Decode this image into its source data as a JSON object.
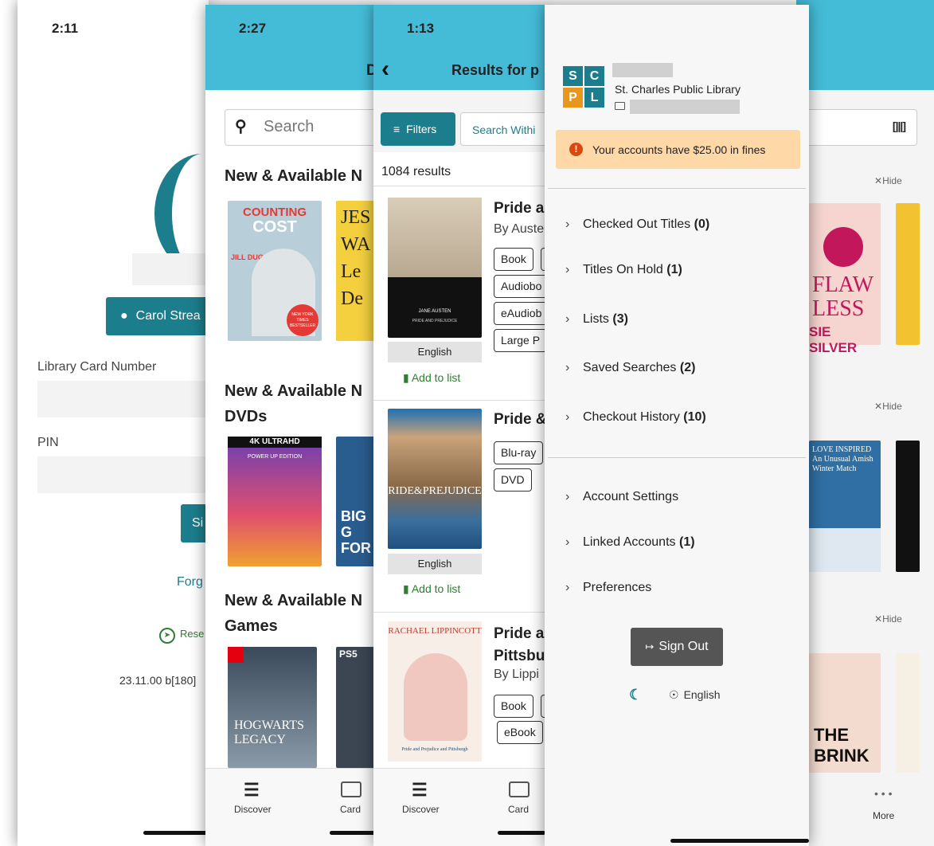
{
  "login": {
    "time": "2:11",
    "location_button": "Carol Strea",
    "card_label": "Library Card Number",
    "pin_label": "PIN",
    "sign_in_partial": "Si",
    "forgot_partial": "Forg",
    "reset_partial": "Rese",
    "version": "23.11.00 b[180]"
  },
  "discover": {
    "time": "2:27",
    "header_partial": "D",
    "search_placeholder": "Search",
    "section1": "New & Available N",
    "section2_line1": "New & Available N",
    "section2_line2": "DVDs",
    "section3_line1": "New & Available N",
    "section3_line2": "Games",
    "covers": [
      {
        "title": "COUNTING THE COST",
        "author": "JILL DUGGAR",
        "badge": "NEW YORK TIMES BESTSELLER"
      },
      {
        "title": "JES WA Le De",
        "author": ""
      },
      {
        "title": "4K ULTRAHD",
        "subtitle": "POWER UP EDITION"
      },
      {
        "title": "BIG G FOR",
        "author": ""
      },
      {
        "title": "HOGWARTS LEGACY",
        "author": ""
      },
      {
        "title": "PS5",
        "author": ""
      }
    ],
    "nav": {
      "discover": "Discover",
      "card": "Card"
    }
  },
  "results": {
    "time": "1:13",
    "title": "Results for p",
    "filters": "Filters",
    "search_within": "Search Withi",
    "count": "1084 results",
    "items": [
      {
        "title": "Pride a",
        "author": "By Auste",
        "formats": [
          "Book",
          "Audiobo",
          "eAudiob",
          "Large P"
        ],
        "language": "English",
        "add": "Add to list",
        "cover_lines": [
          "JANE AUSTEN",
          "PRIDE AND PREJUDICE"
        ]
      },
      {
        "title": "Pride &",
        "author": "",
        "formats": [
          "Blu-ray",
          "DVD"
        ],
        "language": "English",
        "add": "Add to list",
        "cover_lines": [
          "RIDE&PREJUDICE"
        ]
      },
      {
        "title": "Pride a",
        "title2": "Pittsbu",
        "author": "By Lippi",
        "formats": [
          "Book",
          "eBook"
        ],
        "cover_lines": [
          "RACHAEL LIPPINCOTT",
          "Pride and Prejudice and Pittsburgh"
        ]
      }
    ],
    "nav": {
      "discover": "Discover",
      "card": "Card"
    }
  },
  "account": {
    "library_name": "St. Charles Public Library",
    "logo_letters": [
      "S",
      "C",
      "P",
      "L"
    ],
    "fines_message": "Your accounts have $25.00 in fines",
    "menu": [
      "Checked Out Titles",
      "Titles On Hold",
      "Lists",
      "Saved Searches",
      "Checkout History"
    ],
    "menu_counts": [
      "(0)",
      "(1)",
      "(3)",
      "(2)",
      "(10)"
    ],
    "menu2": [
      "Account Settings",
      "Linked Accounts",
      "Preferences"
    ],
    "menu2_counts": [
      "",
      "(1)",
      ""
    ],
    "sign_out": "Sign Out",
    "language": "English"
  },
  "background": {
    "hide": "Hide",
    "more": "More",
    "covers": [
      "FLAW LESS",
      "SIE SILVER",
      "LOVE INSPIRED An Unusual Amish Winter Match",
      "THE BRINK"
    ]
  },
  "colors": {
    "header": "#44bcd8",
    "teal_button": "#1c7e8d",
    "fines_bg": "#ffd8a8",
    "fines_icon": "#d9480f"
  }
}
